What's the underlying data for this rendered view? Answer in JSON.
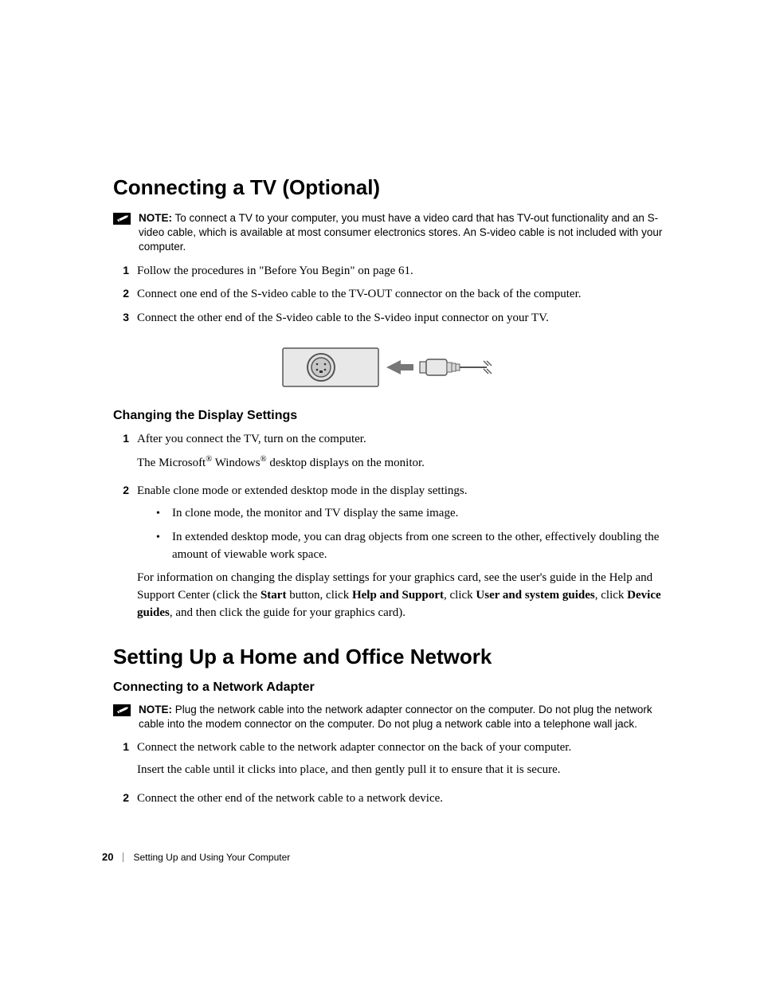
{
  "section1": {
    "heading": "Connecting a TV (Optional)",
    "note_label": "NOTE:",
    "note_text": "To connect a TV to your computer, you must have a video card that has TV-out functionality and an S-video cable, which is available at most consumer electronics stores. An S-video cable is not included with your computer.",
    "steps": [
      "Follow the procedures in \"Before You Begin\" on page 61.",
      "Connect one end of the S-video cable to the TV-OUT connector on the back of the computer.",
      "Connect the other end of the S-video cable to the S-video input connector on your TV."
    ]
  },
  "section1b": {
    "heading": "Changing the Display Settings",
    "step1_line1": "After you connect the TV, turn on the computer.",
    "step1_line2_a": "The Microsoft",
    "step1_line2_b": " Windows",
    "step1_line2_c": " desktop displays on the monitor.",
    "step2_intro": "Enable clone mode or extended desktop mode in the display settings.",
    "step2_bullet1": "In clone mode, the monitor and TV display the same image.",
    "step2_bullet2": "In extended desktop mode, you can drag objects from one screen to the other, effectively doubling the amount of viewable work space.",
    "step2_para_a": "For information on changing the display settings for your graphics card, see the user's guide in the Help and Support Center (click the ",
    "step2_para_b": "Start",
    "step2_para_c": " button, click ",
    "step2_para_d": "Help and Support",
    "step2_para_e": ", click ",
    "step2_para_f": "User and system guides",
    "step2_para_g": ", click ",
    "step2_para_h": "Device guides",
    "step2_para_i": ", and then click the guide for your graphics card)."
  },
  "section2": {
    "heading": "Setting Up a Home and Office Network",
    "sub_heading": "Connecting to a Network Adapter",
    "note_label": "NOTE:",
    "note_text": "Plug the network cable into the network adapter connector on the computer. Do not plug the network cable into the modem connector on the computer. Do not plug a network cable into a telephone wall jack.",
    "step1_line1": "Connect the network cable to the network adapter connector on the back of your computer.",
    "step1_line2": "Insert the cable until it clicks into place, and then gently pull it to ensure that it is secure.",
    "step2": "Connect the other end of the network cable to a network device."
  },
  "footer": {
    "page_number": "20",
    "chapter": "Setting Up and Using Your Computer"
  }
}
